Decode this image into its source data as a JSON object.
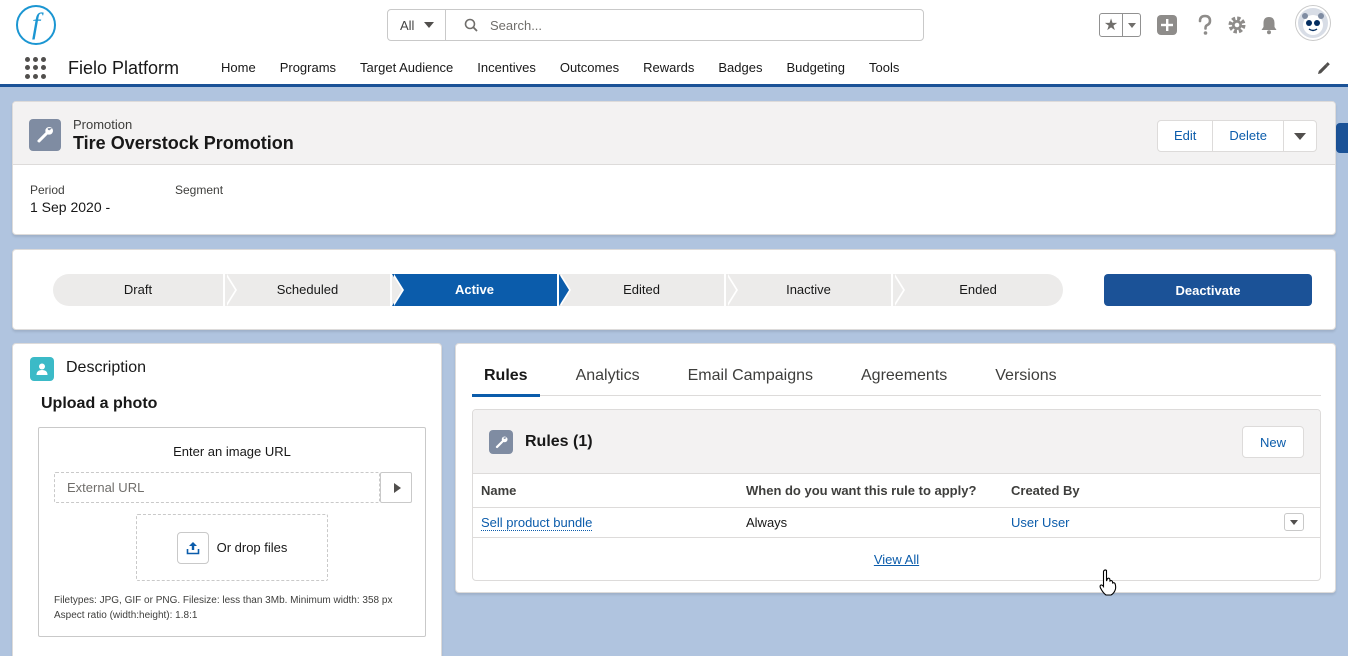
{
  "header": {
    "logo_letter": "f",
    "search": {
      "scope": "All",
      "placeholder": "Search..."
    }
  },
  "nav": {
    "app_name": "Fielo Platform",
    "items": [
      "Home",
      "Programs",
      "Target Audience",
      "Incentives",
      "Outcomes",
      "Rewards",
      "Badges",
      "Budgeting",
      "Tools"
    ]
  },
  "record": {
    "type": "Promotion",
    "title": "Tire Overstock Promotion",
    "actions": {
      "edit": "Edit",
      "delete": "Delete"
    },
    "fields": {
      "period_label": "Period",
      "period_value": "1 Sep 2020 -",
      "segment_label": "Segment"
    }
  },
  "path": {
    "stages": [
      "Draft",
      "Scheduled",
      "Active",
      "Edited",
      "Inactive",
      "Ended"
    ],
    "active": "Active",
    "action": "Deactivate"
  },
  "description": {
    "title": "Description",
    "upload_title": "Upload a photo",
    "enter_url": "Enter an image URL",
    "url_placeholder": "External URL",
    "drop_text": "Or drop files",
    "hint_line1": "Filetypes: JPG, GIF or PNG. Filesize: less than 3Mb. Minimum width: 358 px",
    "hint_line2": "Aspect ratio (width:height): 1.8:1"
  },
  "related": {
    "tabs": [
      "Rules",
      "Analytics",
      "Email Campaigns",
      "Agreements",
      "Versions"
    ],
    "active_tab": "Rules",
    "rules": {
      "title": "Rules (1)",
      "new_label": "New",
      "columns": [
        "Name",
        "When do you want this rule to apply?",
        "Created By"
      ],
      "rows": [
        {
          "name": "Sell product bundle",
          "when": "Always",
          "created_by": "User User"
        }
      ],
      "view_all": "View All"
    }
  },
  "colors": {
    "brand": "#1b5297",
    "accent": "#0b5cab",
    "background": "#b0c4df"
  }
}
